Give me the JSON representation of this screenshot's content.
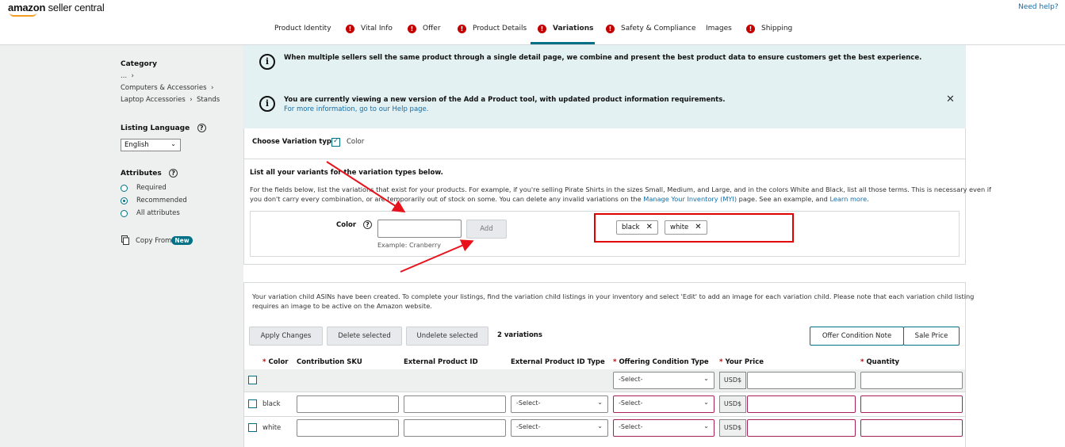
{
  "header": {
    "logo_brand": "amazon",
    "logo_suffix": " seller central",
    "need_help": "Need help?"
  },
  "tabs": [
    {
      "label": "Product Identity",
      "error": false,
      "active": false
    },
    {
      "label": "Vital Info",
      "error": true,
      "active": false
    },
    {
      "label": "Offer",
      "error": true,
      "active": false
    },
    {
      "label": "Product Details",
      "error": true,
      "active": false
    },
    {
      "label": "Variations",
      "error": true,
      "active": true
    },
    {
      "label": "Safety & Compliance",
      "error": true,
      "active": false
    },
    {
      "label": "Images",
      "error": false,
      "active": false
    },
    {
      "label": "Shipping",
      "error": true,
      "active": false
    }
  ],
  "sidebar": {
    "category_title": "Category",
    "category_ellipsis": "...",
    "category_level1": "Computers & Accessories",
    "category_level2a": "Laptop Accessories",
    "category_level2b": "Stands",
    "language_title": "Listing Language",
    "language_value": "English",
    "attributes_title": "Attributes",
    "attributes": [
      {
        "label": "Required",
        "selected": false
      },
      {
        "label": "Recommended",
        "selected": true
      },
      {
        "label": "All attributes",
        "selected": false
      }
    ],
    "copy_from": "Copy From",
    "new_badge": "New"
  },
  "alerts": {
    "alert1": "When multiple sellers sell the same product through a single detail page, we combine and present the best product data to ensure customers get the best experience.",
    "alert2_title": "You are currently viewing a new version of the Add a Product tool, with updated product information requirements.",
    "alert2_link": "For more information, go to our Help page."
  },
  "variation_type": {
    "label": "Choose Variation type:",
    "option": "Color"
  },
  "variants": {
    "heading": "List all your variants for the variation types below.",
    "desc_part1": "For the fields below, list the variations that exist for your products. For example, if you're selling Pirate Shirts in the sizes Small, Medium, and Large, and in the colors White and Black, list all those terms. This is necessary even if",
    "desc_part2": "you don't carry every combination, or are temporarily out of stock on some. You can delete any invalid variations on the ",
    "desc_link1": "Manage Your Inventory (MYI)",
    "desc_part3": " page. See an example, and ",
    "desc_link2": "Learn more",
    "desc_end": ".",
    "color_label": "Color",
    "add_button": "Add",
    "example": "Example: Cranberry",
    "chips": [
      "black",
      "white"
    ]
  },
  "child_table": {
    "notice_line1": "Your variation child ASINs have been created. To complete your listings, find the variation child listings in your inventory and select 'Edit' to add an image for each variation child. Please note that each variation child listing",
    "notice_line2": "requires an image to be active on the Amazon website.",
    "apply_changes": "Apply Changes",
    "delete_selected": "Delete selected",
    "undelete_selected": "Undelete selected",
    "count": "2 variations",
    "offer_condition_note": "Offer Condition Note",
    "sale_price": "Sale Price",
    "columns": {
      "color": "Color",
      "contribution_sku": "Contribution SKU",
      "external_id": "External Product ID",
      "external_id_type": "External Product ID Type",
      "offering_condition": "Offering Condition Type",
      "your_price": "Your Price",
      "quantity": "Quantity"
    },
    "select_placeholder": "-Select-",
    "currency": "USD$",
    "rows": [
      {
        "color": "black"
      },
      {
        "color": "white"
      }
    ]
  },
  "colors": {
    "accent": "#007185",
    "error": "#c40000",
    "highlight_box": "#e00000",
    "arrow": "#e8121c"
  }
}
